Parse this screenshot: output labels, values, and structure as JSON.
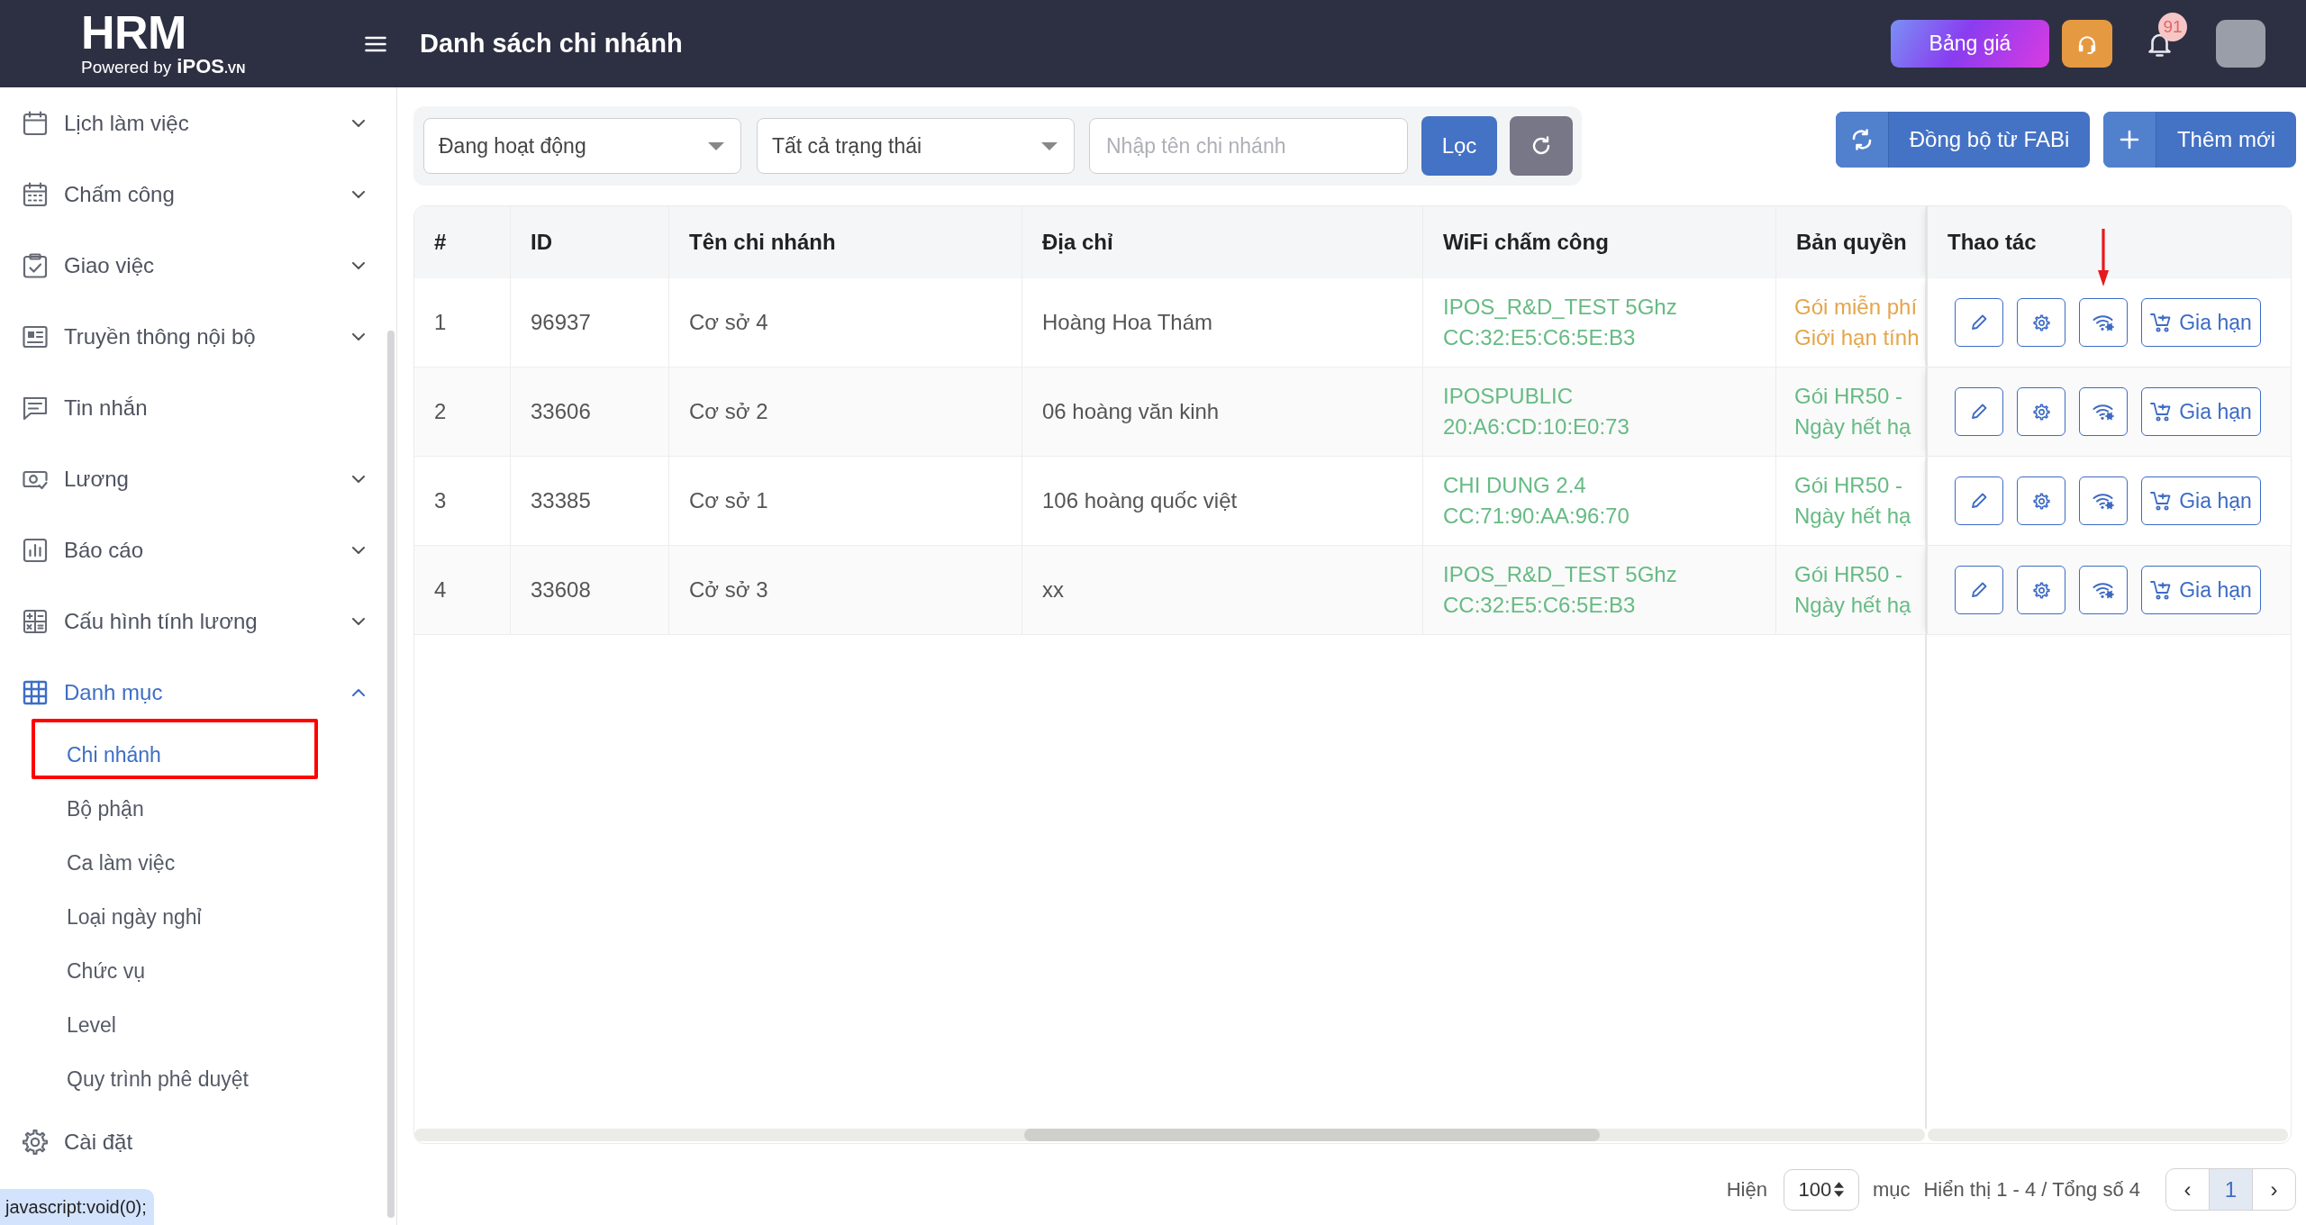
{
  "header": {
    "logo": {
      "title": "HRM",
      "tagline": "Powered by",
      "brand": "iPOS",
      "brand_suffix": ".VN"
    },
    "page_title": "Danh sách chi nhánh",
    "pricing_button": "Bảng giá",
    "notification_count": "91"
  },
  "sidebar": {
    "items": [
      {
        "label": "Lịch làm việc",
        "kind": "group",
        "expanded": false,
        "selected": false
      },
      {
        "label": "Chấm công",
        "kind": "group",
        "expanded": false,
        "selected": false
      },
      {
        "label": "Giao việc",
        "kind": "group",
        "expanded": false,
        "selected": false
      },
      {
        "label": "Truyền thông nội bộ",
        "kind": "group",
        "expanded": false,
        "selected": false
      },
      {
        "label": "Tin nhắn",
        "kind": "link",
        "selected": false
      },
      {
        "label": "Lương",
        "kind": "group",
        "expanded": false,
        "selected": false
      },
      {
        "label": "Báo cáo",
        "kind": "group",
        "expanded": false,
        "selected": false
      },
      {
        "label": "Cấu hình tính lương",
        "kind": "group",
        "expanded": false,
        "selected": false
      },
      {
        "label": "Danh mục",
        "kind": "group",
        "expanded": true,
        "selected": true,
        "children": [
          {
            "label": "Chi nhánh",
            "selected": true,
            "annotated": true
          },
          {
            "label": "Bộ phận",
            "selected": false,
            "annotated": false
          },
          {
            "label": "Ca làm việc",
            "selected": false,
            "annotated": false
          },
          {
            "label": "Loại ngày nghỉ",
            "selected": false,
            "annotated": false
          },
          {
            "label": "Chức vụ",
            "selected": false,
            "annotated": false
          },
          {
            "label": "Level",
            "selected": false,
            "annotated": false
          },
          {
            "label": "Quy trình phê duyệt",
            "selected": false,
            "annotated": false
          }
        ]
      },
      {
        "label": "Cài đặt",
        "kind": "link",
        "selected": false
      }
    ]
  },
  "filters": {
    "status_select": "Đang hoạt động",
    "state_select": "Tất cả trạng thái",
    "search": {
      "placeholder": "Nhập tên chi nhánh"
    },
    "filter_button": "Lọc"
  },
  "toolbar_actions": {
    "sync_button": "Đồng bộ từ FABi",
    "add_button": "Thêm mới"
  },
  "table": {
    "columns": [
      "#",
      "ID",
      "Tên chi nhánh",
      "Địa chỉ",
      "WiFi chấm công",
      "Bản quyền",
      "Thao tác"
    ],
    "rows": [
      {
        "index": "1",
        "id": "96937",
        "name": "Cơ sở 4",
        "address": "Hoàng Hoa Thám",
        "wifi": [
          "IPOS_R&D_TEST 5Ghz",
          "CC:32:E5:C6:5E:B3"
        ],
        "license": {
          "lines": [
            "Gói miễn phí",
            "Giới hạn tính"
          ],
          "color": "#e5a54b"
        },
        "actions": [
          {
            "kind": "edit",
            "annotated": false
          },
          {
            "kind": "settings",
            "annotated": false
          },
          {
            "kind": "wifi",
            "annotated": true
          },
          {
            "kind": "renew",
            "label": "Gia hạn",
            "annotated": false
          }
        ]
      },
      {
        "index": "2",
        "id": "33606",
        "name": "Cơ sở 2",
        "address": "06 hoàng văn kinh",
        "wifi": [
          "IPOSPUBLIC",
          "20:A6:CD:10:E0:73"
        ],
        "license": {
          "lines": [
            "Gói HR50 -",
            "Ngày hết hạ"
          ],
          "color": "#66bb83"
        },
        "actions": [
          {
            "kind": "edit",
            "annotated": false
          },
          {
            "kind": "settings",
            "annotated": false
          },
          {
            "kind": "wifi",
            "annotated": false
          },
          {
            "kind": "renew",
            "label": "Gia hạn",
            "annotated": false
          }
        ]
      },
      {
        "index": "3",
        "id": "33385",
        "name": "Cơ sở 1",
        "address": "106 hoàng quốc việt",
        "wifi": [
          "CHI DUNG 2.4",
          "CC:71:90:AA:96:70"
        ],
        "license": {
          "lines": [
            "Gói HR50 -",
            "Ngày hết hạ"
          ],
          "color": "#66bb83"
        },
        "actions": [
          {
            "kind": "edit",
            "annotated": false
          },
          {
            "kind": "settings",
            "annotated": false
          },
          {
            "kind": "wifi",
            "annotated": false
          },
          {
            "kind": "renew",
            "label": "Gia hạn",
            "annotated": false
          }
        ]
      },
      {
        "index": "4",
        "id": "33608",
        "name": "Cở sở 3",
        "address": "xx",
        "wifi": [
          "IPOS_R&D_TEST 5Ghz",
          "CC:32:E5:C6:5E:B3"
        ],
        "license": {
          "lines": [
            "Gói HR50 -",
            "Ngày hết hạ"
          ],
          "color": "#66bb83"
        },
        "actions": [
          {
            "kind": "edit",
            "annotated": false
          },
          {
            "kind": "settings",
            "annotated": false
          },
          {
            "kind": "wifi",
            "annotated": false
          },
          {
            "kind": "renew",
            "label": "Gia hạn",
            "annotated": false
          }
        ]
      }
    ]
  },
  "footer": {
    "page_size_label": "Hiện",
    "page_size": "100",
    "page_size_unit": "mục",
    "summary": "Hiển thị 1 - 4 / Tổng số 4",
    "prev": "‹",
    "pages": [
      {
        "label": "1",
        "selected": true
      }
    ],
    "next": "›"
  },
  "status_bubble": "javascript:void(0);"
}
